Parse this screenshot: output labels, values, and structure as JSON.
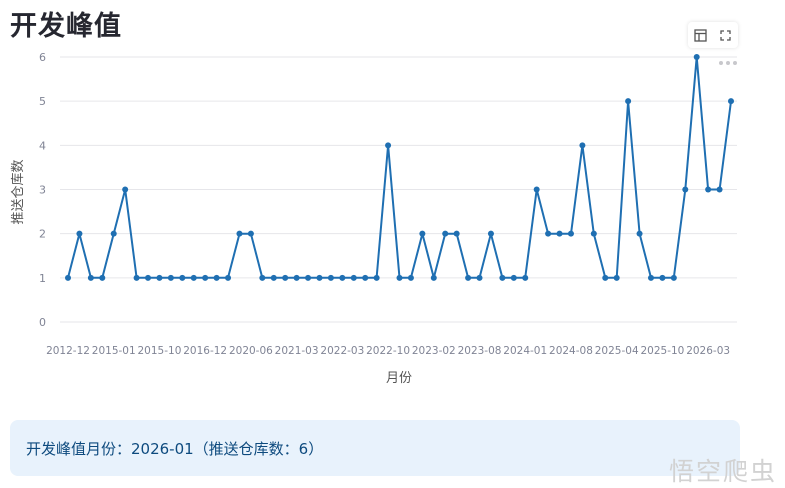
{
  "page": {
    "title": "开发峰值"
  },
  "toolbar": {
    "items": [
      "table-view-icon",
      "fullscreen-icon",
      "more-icon"
    ]
  },
  "colors": {
    "line": "#1f6fb2",
    "grid": "#e6e6ea",
    "axis_text": "#808495",
    "info_bg": "#e8f2fc",
    "info_text": "#0d4a7e"
  },
  "chart_data": {
    "type": "line",
    "xlabel": "月份",
    "ylabel": "推送仓库数",
    "ylim": [
      0,
      6
    ],
    "yticks": [
      0,
      1,
      2,
      3,
      4,
      5,
      6
    ],
    "grid": true,
    "xtick_labels": [
      "2012-12",
      "2015-01",
      "2015-10",
      "2016-12",
      "2020-06",
      "2021-03",
      "2022-03",
      "2022-10",
      "2023-02",
      "2023-08",
      "2024-01",
      "2024-08",
      "2025-04",
      "2025-10",
      "2026-03"
    ],
    "xtick_index": [
      0,
      4,
      8,
      12,
      16,
      20,
      24,
      28,
      32,
      36,
      40,
      44,
      48,
      52,
      56
    ],
    "values": [
      1,
      2,
      1,
      1,
      2,
      3,
      1,
      1,
      1,
      1,
      1,
      1,
      1,
      1,
      1,
      2,
      2,
      1,
      1,
      1,
      1,
      1,
      1,
      1,
      1,
      1,
      1,
      1,
      4,
      1,
      1,
      2,
      1,
      2,
      2,
      1,
      1,
      2,
      1,
      1,
      1,
      3,
      2,
      2,
      2,
      4,
      2,
      1,
      1,
      5,
      2,
      1,
      1,
      1,
      3,
      6,
      3,
      3,
      5
    ]
  },
  "info": {
    "text": "开发峰值月份：2026-01（推送仓库数：6）"
  },
  "watermark": {
    "text": "悟空爬虫"
  }
}
